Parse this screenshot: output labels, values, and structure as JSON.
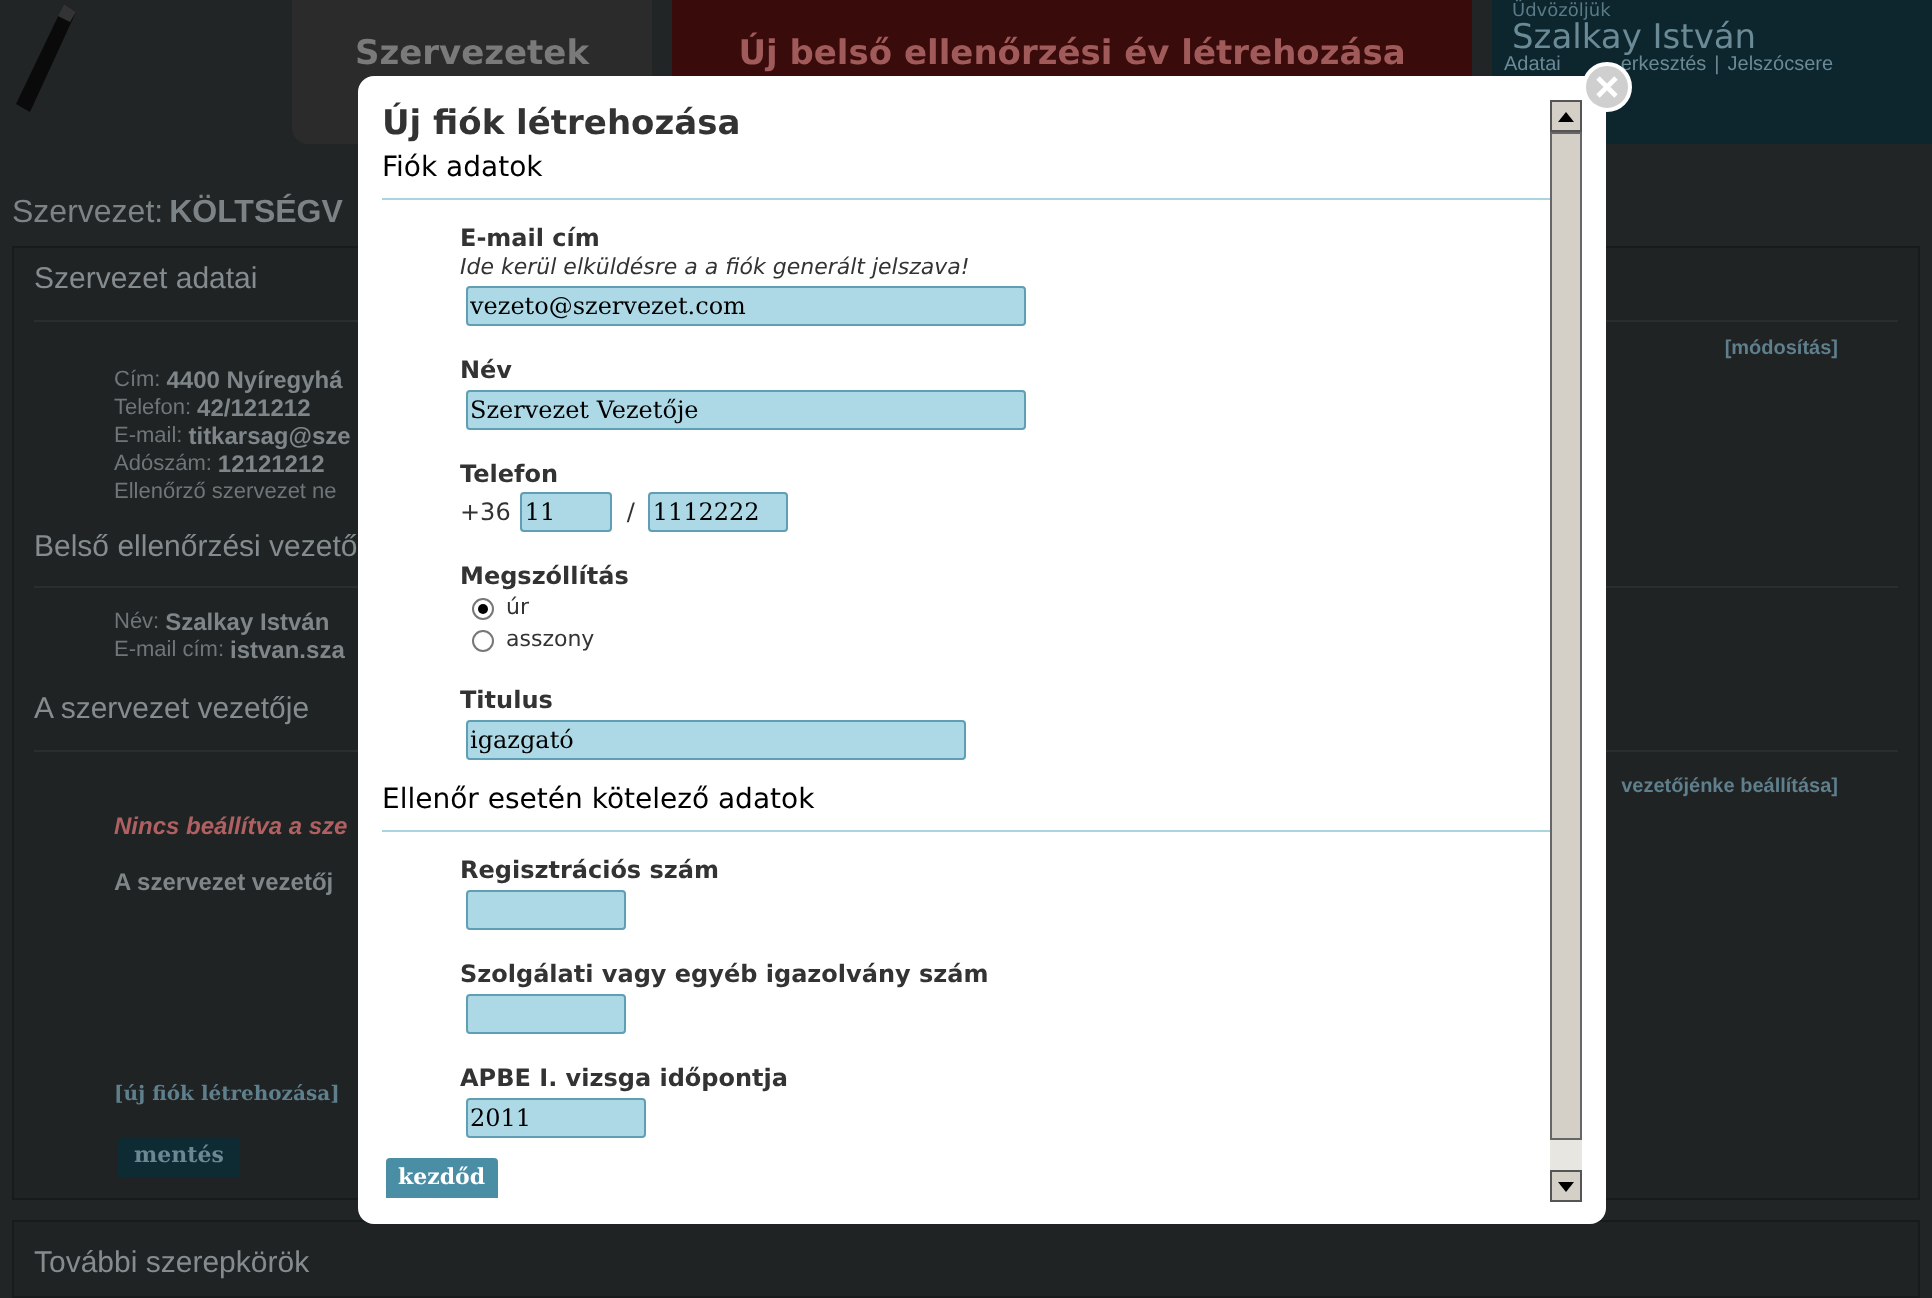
{
  "header": {
    "nav": [
      {
        "label": "Szervezetek",
        "kind": "plain"
      },
      {
        "label": "Új belső ellenőrzési év létrehozása",
        "kind": "highlight"
      }
    ],
    "user": {
      "greeting": "Üdvözöljük",
      "name": "Szalkay István",
      "link_parts": [
        "Adatai",
        "erkesztés"
      ],
      "separator": "|",
      "last_link": "Jelszócsere"
    }
  },
  "page": {
    "title_prefix": "Szervezet:",
    "title_bold": "KÖLTSÉGV",
    "sections": [
      {
        "heading": "Szervezet adatai",
        "action": "[módosítás]",
        "rows": [
          {
            "label": "Cím:",
            "value": "4400 Nyíregyhá"
          },
          {
            "label": "Telefon:",
            "value": "42/121212"
          },
          {
            "label": "E-mail:",
            "value": "titkarsag@sze"
          },
          {
            "label": "Adószám:",
            "value": "12121212"
          },
          {
            "label": "Ellenőrző szervezet ne"
          }
        ]
      },
      {
        "heading": "Belső ellenőrzési vezető",
        "rows": [
          {
            "label": "Név:",
            "value": "Szalkay István"
          },
          {
            "label": "E-mail cím:",
            "value": "istvan.sza"
          }
        ]
      },
      {
        "heading": "A szervezet vezetője",
        "action": "vezetőjénke beállítása]",
        "warning": "Nincs beállítva a sze",
        "note": "A szervezet vezetőj",
        "link": "[új fiók létrehozása]",
        "button": "mentés"
      }
    ],
    "more_heading": "További szerepkörök"
  },
  "dialog": {
    "title": "Új fiók létrehozása",
    "submit": "kezdőd",
    "sections": [
      {
        "heading": "Fiók adatok",
        "fields": [
          {
            "kind": "text",
            "label": "E-mail cím",
            "hint": "Ide kerül elküldésre a a fiók generált jelszava!",
            "value": "vezeto@szervezet.com"
          },
          {
            "kind": "text",
            "label": "Név",
            "value": "Szervezet Vezetője"
          },
          {
            "kind": "phone",
            "label": "Telefon",
            "prefix": "+36",
            "area": "11",
            "separator": "/",
            "number": "1112222"
          },
          {
            "kind": "radio",
            "label": "Megszóllítás",
            "options": [
              {
                "label": "úr",
                "selected": true
              },
              {
                "label": "asszony",
                "selected": false
              }
            ]
          },
          {
            "kind": "text",
            "label": "Titulus",
            "value": "igazgató"
          }
        ]
      },
      {
        "heading": "Ellenőr esetén kötelező adatok",
        "fields": [
          {
            "kind": "text",
            "label": "Regisztrációs szám"
          },
          {
            "kind": "text",
            "label": "Szolgálati vagy egyéb igazolvány szám"
          },
          {
            "kind": "text",
            "label": "APBE I. vizsga időpontja",
            "value": "2011"
          }
        ]
      }
    ]
  }
}
